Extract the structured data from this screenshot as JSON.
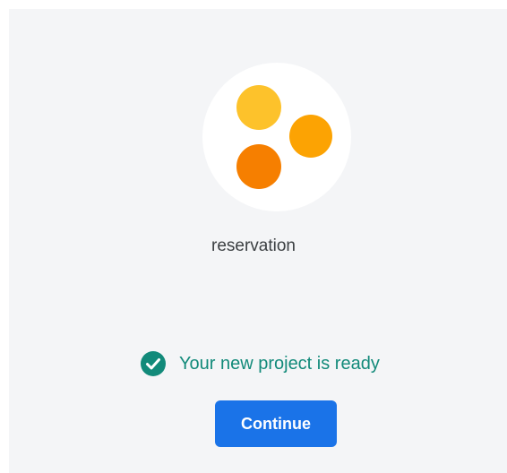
{
  "project": {
    "name": "reservation",
    "icon": {
      "name": "project-dots-icon",
      "colors": {
        "top": "#fdc22b",
        "right": "#fca303",
        "bottom": "#f67f00"
      }
    }
  },
  "status": {
    "icon": "check-circle-icon",
    "text": "Your new project is ready",
    "color": "#128a7a"
  },
  "actions": {
    "continue_label": "Continue",
    "continue_color": "#1a73e8"
  }
}
